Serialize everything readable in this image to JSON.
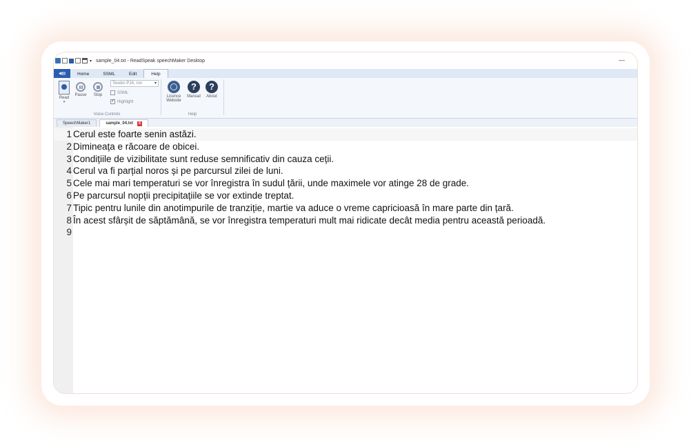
{
  "window": {
    "title": "sample_04.txt - ReadSpeak speechMaker Desktop",
    "minimize": "—"
  },
  "quick_access": {
    "dropdown": "▾"
  },
  "ribbon_tabs": [
    "Home",
    "SSML",
    "Edit",
    "Help"
  ],
  "active_ribbon_tab": "Help",
  "ribbon": {
    "voice_controls": {
      "read_label": "Read",
      "read_dropdown": "▾",
      "pause_label": "Pause",
      "stop_label": "Stop",
      "voice_value": "Teodor-P16, ron",
      "voice_arrow": "▾",
      "ssml_label": "SSML",
      "highlight_label": "Highlight",
      "group_label": "Voice Controls"
    },
    "help": {
      "licence_label_1": "Licence",
      "licence_label_2": "Website",
      "manual_label": "Manual",
      "about_label": "About",
      "question_glyph": "?",
      "group_label": "Help"
    }
  },
  "doc_tabs": [
    "SpeechMaker1",
    "sample_04.txt"
  ],
  "active_doc_tab": "sample_04.txt",
  "close_glyph": "x",
  "editor": {
    "lines": [
      {
        "num": "1",
        "text": "Cerul este foarte senin astăzi."
      },
      {
        "num": "2",
        "text": "Dimineața e răcoare de obicei."
      },
      {
        "num": "3",
        "text": "Condițiile de vizibilitate sunt reduse semnificativ din cauza ceții."
      },
      {
        "num": "4",
        "text": "Cerul va fi parțial noros și pe parcursul zilei de luni."
      },
      {
        "num": "5",
        "text": "Cele mai mari temperaturi se vor înregistra în sudul țării, unde maximele vor atinge 28 de grade."
      },
      {
        "num": "6",
        "text": "Pe parcursul nopții precipitațiile se vor extinde treptat."
      },
      {
        "num": "7",
        "text": "Tipic pentru lunile din anotimpurile de tranziție, martie va aduce o vreme capricioasă în mare parte din țară."
      },
      {
        "num": "8",
        "text": "În acest sfârșit de săptămână, se vor înregistra temperaturi mult mai ridicate decât media pentru această perioadă."
      },
      {
        "num": "9",
        "text": ""
      }
    ]
  },
  "colors": {
    "accent": "#2a5db0",
    "ribbon_bg": "#f4f7fc",
    "tabs_bg": "#dfe8f5",
    "close_red": "#d9383a"
  }
}
